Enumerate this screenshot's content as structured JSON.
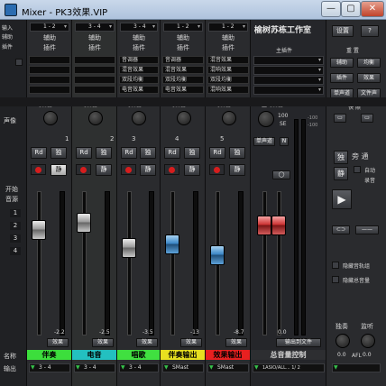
{
  "window": {
    "title": "Mixer - PK3效果.VIP",
    "min": "—",
    "max": "▢",
    "close": "✕"
  },
  "left": {
    "io_label": "输入",
    "aux_label": "辅助",
    "insert_label": "插件",
    "send_label": "声像",
    "open_label": "开始",
    "gain_label": "音源",
    "name_label": "名称",
    "output_label": "输出",
    "numbers": [
      "1",
      "2",
      "3",
      "4"
    ]
  },
  "channels": [
    {
      "id": "1",
      "input": "1 - 2",
      "aux": "辅助",
      "insert": "插件",
      "inserts": [
        "",
        "",
        "",
        ""
      ],
      "eq": "均衡器",
      "rd": "Rd",
      "solo": "独",
      "mute": "静",
      "value": "-2.2",
      "name": "伴奏",
      "name_color": "#3cde3c",
      "effect": "效果",
      "output": "3 - 4"
    },
    {
      "id": "2",
      "input": "3 - 4",
      "aux": "辅助",
      "insert": "插件",
      "inserts": [
        "",
        "",
        "",
        ""
      ],
      "eq": "均衡器",
      "rd": "Rd",
      "solo": "独",
      "mute": "静",
      "value": "-2.5",
      "name": "电音",
      "name_color": "#23c0c0",
      "effect": "效果",
      "output": "3 - 4"
    },
    {
      "id": "3",
      "input": "3 - 4",
      "aux": "辅助",
      "insert": "插件",
      "inserts": [
        "音调器",
        "混音效果",
        "双段均衡",
        "电音效果"
      ],
      "eq": "均衡器",
      "rd": "Rd",
      "solo": "独",
      "mute": "静",
      "value": "-3.5",
      "name": "唱歌",
      "name_color": "#40e040",
      "effect": "效果",
      "output": "3 - 4"
    },
    {
      "id": "4",
      "input": "1 - 2",
      "aux": "辅助",
      "insert": "插件",
      "inserts": [
        "音调器",
        "混音效果",
        "双段均衡",
        "电音效果"
      ],
      "eq": "均衡器",
      "rd": "Rd",
      "solo": "独",
      "mute": "静",
      "value": "-13",
      "name": "伴奏输出",
      "name_color": "#e8e020",
      "effect": "效果",
      "output": "SMast"
    },
    {
      "id": "5",
      "input": "1 - 2",
      "aux": "辅助",
      "insert": "插件",
      "inserts": [
        "混音效果",
        "混响效果",
        "双段均衡",
        "混响效果"
      ],
      "eq": "均衡器",
      "rd": "Rd",
      "solo": "独",
      "mute": "静",
      "value": "-8.7",
      "name": "效果输出",
      "name_color": "#e82020",
      "effect": "效果",
      "output": "SMast"
    }
  ],
  "master": {
    "title": "榆树苏栋工作室",
    "insert": "主插件",
    "eq": "主均衡器",
    "pan_value": "100",
    "pan_unit": "SE",
    "mono_label": "单声道",
    "n_label": "N",
    "value": "0.0",
    "control": "总音量控制",
    "file_label": "输出到文件",
    "output": "1ASIO/ALL... 1/ 2",
    "scale": [
      "12",
      "6",
      "0",
      "6",
      "12",
      "18",
      "24",
      "30",
      "36",
      "42",
      "48",
      "54",
      "60"
    ],
    "scale_right": [
      "-100",
      "-100"
    ]
  },
  "right": {
    "settings": "设置",
    "help": "?",
    "reset": "重 置",
    "buttons": [
      "辅助",
      "均衡",
      "插件",
      "效果",
      "单声道",
      "文件声"
    ],
    "quick": "快 照",
    "solo": "独",
    "mute": "静",
    "cycle": "旁 通",
    "auto": "自动",
    "auto2": "录音",
    "hide_aux": "隐藏音轨组",
    "hide_master": "隐藏总音量",
    "compress_in": "独奏",
    "compress_out": "监听",
    "knob_vals": [
      "0.0",
      "0.0"
    ],
    "out_label": "AFL",
    "link_out": "——"
  },
  "scale_labels": [
    "12",
    "6",
    "0",
    "6",
    "12",
    "18",
    "24",
    "30",
    "36",
    "42",
    "48",
    "54",
    "60"
  ]
}
